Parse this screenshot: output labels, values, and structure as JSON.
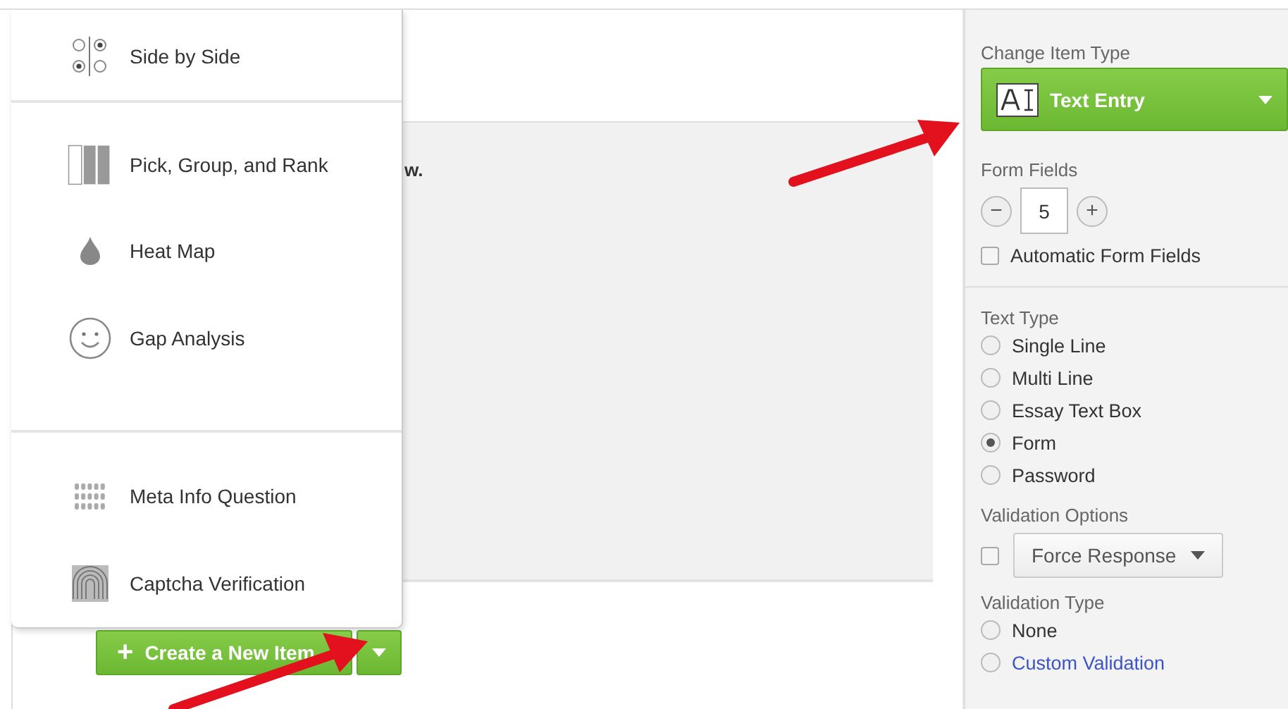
{
  "canvas": {
    "question_text": "w."
  },
  "menu": {
    "groups": [
      {
        "items": [
          {
            "label": "Side by Side",
            "kind": "sidebyside"
          }
        ]
      },
      {
        "items": [
          {
            "label": "Pick, Group, and Rank",
            "kind": "pgr"
          },
          {
            "label": "Heat Map",
            "kind": "heat"
          },
          {
            "label": "Gap Analysis",
            "kind": "gap"
          }
        ]
      },
      {
        "items": [
          {
            "label": "Meta Info Question",
            "kind": "meta"
          },
          {
            "label": "Captcha Verification",
            "kind": "captcha"
          }
        ]
      }
    ]
  },
  "create_button": {
    "label": "Create a New Item",
    "icon": "+"
  },
  "panel": {
    "change_item_type": {
      "label": "Change Item Type",
      "value": "Text Entry"
    },
    "form_fields": {
      "label": "Form Fields",
      "minus": "−",
      "value": "5",
      "plus": "+"
    },
    "automatic_form_fields": {
      "label": "Automatic Form Fields",
      "checked": false
    },
    "text_type": {
      "label": "Text Type",
      "options": [
        {
          "label": "Single Line",
          "selected": false
        },
        {
          "label": "Multi Line",
          "selected": false
        },
        {
          "label": "Essay Text Box",
          "selected": false
        },
        {
          "label": "Form",
          "selected": true
        },
        {
          "label": "Password",
          "selected": false
        }
      ]
    },
    "validation_options": {
      "label": "Validation Options",
      "checked": false,
      "select": "Force Response"
    },
    "validation_type": {
      "label": "Validation Type",
      "options": [
        {
          "label": "None",
          "selected": false,
          "kind": "plain"
        },
        {
          "label": "Custom Validation",
          "selected": false,
          "kind": "link"
        }
      ]
    }
  }
}
